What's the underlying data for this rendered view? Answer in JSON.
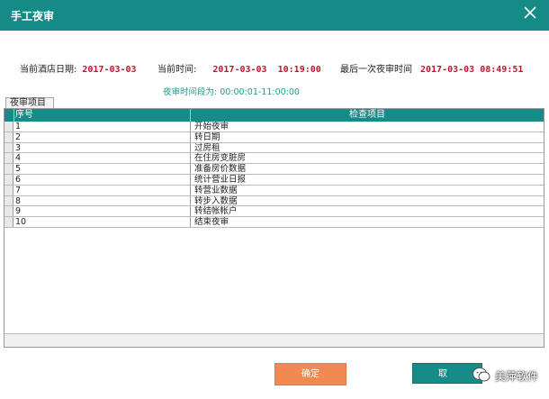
{
  "window": {
    "title": "手工夜审"
  },
  "info": {
    "hotel_date_label": "当前酒店日期:",
    "hotel_date_value": "2017-03-03",
    "current_time_label": "当前时间:",
    "current_time_value": "2017-03-03  10:19:00",
    "last_audit_label": "最后一次夜审时间",
    "last_audit_value": "2017-03-03 08:49:51",
    "audit_period": "夜审时间段为: 00:00:01-11:00:00"
  },
  "tab": {
    "label": "夜审项目"
  },
  "table": {
    "columns": [
      "序号",
      "检查项目"
    ],
    "rows": [
      {
        "no": "1",
        "item": "开始夜审"
      },
      {
        "no": "2",
        "item": "转日期"
      },
      {
        "no": "3",
        "item": "过房租"
      },
      {
        "no": "4",
        "item": "在住房变脏房"
      },
      {
        "no": "5",
        "item": "准备房价数据"
      },
      {
        "no": "6",
        "item": "统计营业日报"
      },
      {
        "no": "7",
        "item": "转营业数据"
      },
      {
        "no": "8",
        "item": "转步入数据"
      },
      {
        "no": "9",
        "item": "转结帐帐户"
      },
      {
        "no": "10",
        "item": "结束夜审"
      }
    ]
  },
  "buttons": {
    "ok": "确定",
    "cancel": "取"
  },
  "watermark": {
    "text": "美萍软件"
  },
  "colors": {
    "accent": "#158c87",
    "value_red": "#c8102e",
    "ok_orange": "#f08a52"
  }
}
